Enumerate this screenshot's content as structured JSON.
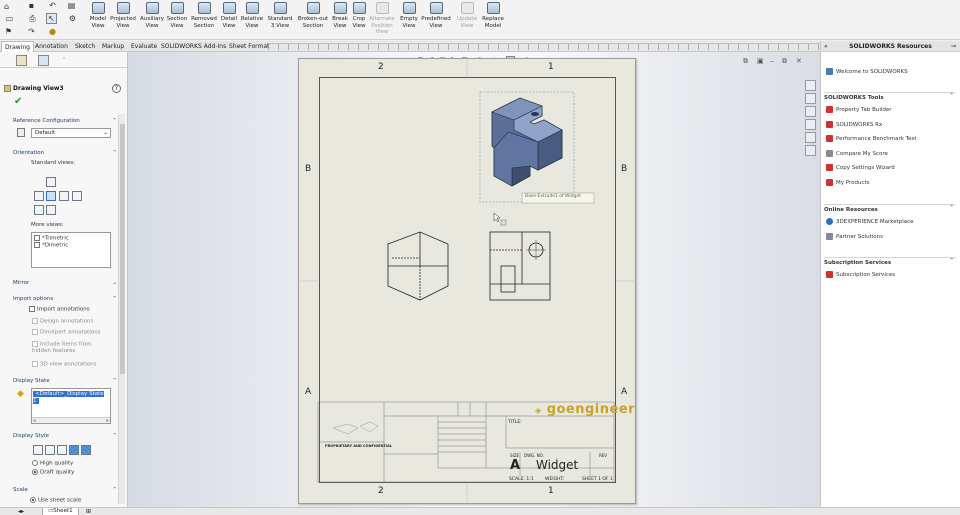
{
  "toolbar": {
    "buttons": [
      {
        "label": "Model\nView",
        "enabled": true
      },
      {
        "label": "Projected\nView",
        "enabled": true
      },
      {
        "label": "Auxiliary\nView",
        "enabled": true
      },
      {
        "label": "Section\nView",
        "enabled": true
      },
      {
        "label": "Removed\nSection",
        "enabled": true
      },
      {
        "label": "Detail\nView",
        "enabled": true
      },
      {
        "label": "Relative\nView",
        "enabled": true
      },
      {
        "label": "Standard\n3 View",
        "enabled": true
      },
      {
        "label": "Broken-out\nSection",
        "enabled": true
      },
      {
        "label": "Break\nView",
        "enabled": true
      },
      {
        "label": "Crop\nView",
        "enabled": true
      },
      {
        "label": "Alternate\nPosition\nView",
        "enabled": false
      },
      {
        "label": "Empty\nView",
        "enabled": true
      },
      {
        "label": "Predefined\nView",
        "enabled": true
      },
      {
        "label": "Update\nView",
        "enabled": false
      },
      {
        "label": "Replace\nModel",
        "enabled": true
      }
    ]
  },
  "command_tabs": [
    "Drawing",
    "Annotation",
    "Sketch",
    "Markup",
    "Evaluate",
    "SOLIDWORKS Add-Ins",
    "Sheet Format"
  ],
  "active_tab": "Drawing",
  "task_pane": {
    "title": "SOLIDWORKS Resources",
    "welcome": "Welcome to SOLIDWORKS",
    "sections": [
      {
        "title": "SOLIDWORKS Tools",
        "items": [
          "Property Tab Builder",
          "SOLIDWORKS Rx",
          "Performance Benchmark Test",
          "Compare My Score",
          "Copy Settings Wizard",
          "My Products"
        ]
      },
      {
        "title": "Online Resources",
        "items": [
          "3DEXPERIENCE Marketplace",
          "Partner Solutions"
        ]
      },
      {
        "title": "Subscription Services",
        "items": [
          "Subscription Services"
        ]
      }
    ]
  },
  "property_manager": {
    "title": "Drawing View3",
    "reference_configuration": {
      "label": "Reference Configuration",
      "value": "Default"
    },
    "orientation": {
      "label": "Orientation",
      "standard_views_label": "Standard views:",
      "more_views_label": "More views:",
      "more_views": [
        "*Trimetric",
        "*Dimetric"
      ]
    },
    "mirror_label": "Mirror",
    "import_options": {
      "label": "Import options",
      "import_annotations": "Import annotations",
      "design_annotations": "Design annotations",
      "dimxpert_annotations": "DimXpert annotations",
      "include_hidden": "Include items from hidden features",
      "view_3d_annotations": "3D view annotations"
    },
    "display_state": {
      "label": "Display State",
      "selected": "<Default>_Display State 1"
    },
    "display_style": {
      "label": "Display Style",
      "high_quality": "High quality",
      "draft_quality": "Draft quality"
    },
    "scale": {
      "label": "Scale",
      "use_sheet_scale": "Use sheet scale"
    }
  },
  "drawing": {
    "zones_top": [
      "2",
      "1"
    ],
    "zones_side": [
      "B",
      "A"
    ],
    "tooltip": "Base Extrude1 of Widget",
    "title_block": {
      "company": "goengineer",
      "title_label": "TITLE:",
      "size_label": "SIZE",
      "size": "A",
      "dwg_no_label": "DWG. NO.",
      "dwg_no": "Widget",
      "rev_label": "REV",
      "scale": "SCALE: 1:1",
      "weight": "WEIGHT:",
      "sheet": "SHEET 1 OF 1",
      "proprietary": "PROPRIETARY AND CONFIDENTIAL"
    }
  },
  "status": {
    "sheet_tab": "Sheet1"
  }
}
